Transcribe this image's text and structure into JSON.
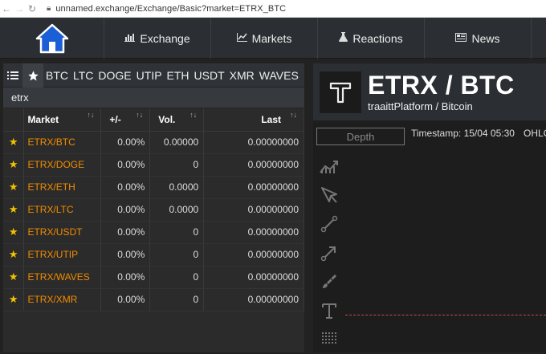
{
  "browser": {
    "url": "unnamed.exchange/Exchange/Basic?market=ETRX_BTC"
  },
  "nav": {
    "items": [
      {
        "label": "Exchange",
        "icon": "bar-chart-icon"
      },
      {
        "label": "Markets",
        "icon": "line-chart-icon"
      },
      {
        "label": "Reactions",
        "icon": "flask-icon"
      },
      {
        "label": "News",
        "icon": "newspaper-icon"
      }
    ]
  },
  "market_tabs": [
    "BTC",
    "LTC",
    "DOGE",
    "UTIP",
    "ETH",
    "USDT",
    "XMR",
    "WAVES"
  ],
  "search": {
    "value": "etrx"
  },
  "table": {
    "headers": {
      "market": "Market",
      "change": "+/-",
      "volume": "Vol.",
      "last": "Last"
    },
    "rows": [
      {
        "market": "ETRX/BTC",
        "change": "0.00%",
        "volume": "0.00000",
        "last": "0.00000000"
      },
      {
        "market": "ETRX/DOGE",
        "change": "0.00%",
        "volume": "0",
        "last": "0.00000000"
      },
      {
        "market": "ETRX/ETH",
        "change": "0.00%",
        "volume": "0.0000",
        "last": "0.00000000"
      },
      {
        "market": "ETRX/LTC",
        "change": "0.00%",
        "volume": "0.0000",
        "last": "0.00000000"
      },
      {
        "market": "ETRX/USDT",
        "change": "0.00%",
        "volume": "0",
        "last": "0.00000000"
      },
      {
        "market": "ETRX/UTIP",
        "change": "0.00%",
        "volume": "0",
        "last": "0.00000000"
      },
      {
        "market": "ETRX/WAVES",
        "change": "0.00%",
        "volume": "0",
        "last": "0.00000000"
      },
      {
        "market": "ETRX/XMR",
        "change": "0.00%",
        "volume": "0",
        "last": "0.00000000"
      }
    ]
  },
  "pair": {
    "title": "ETRX / BTC",
    "subtitle": "traaittPlatform / Bitcoin"
  },
  "chart": {
    "depth_label": "Depth",
    "timestamp": "Timestamp: 15/04 05:30",
    "ohlc": "OHLC",
    "tools": [
      "trend-icon",
      "cursor-arrow-icon",
      "line-tool-icon",
      "arrow-line-icon",
      "brush-icon",
      "text-tool-icon",
      "grid-icon"
    ]
  },
  "colors": {
    "accent_orange": "#f28c00",
    "star_yellow": "#f2c200",
    "logo_blue": "#1a5fd6"
  }
}
